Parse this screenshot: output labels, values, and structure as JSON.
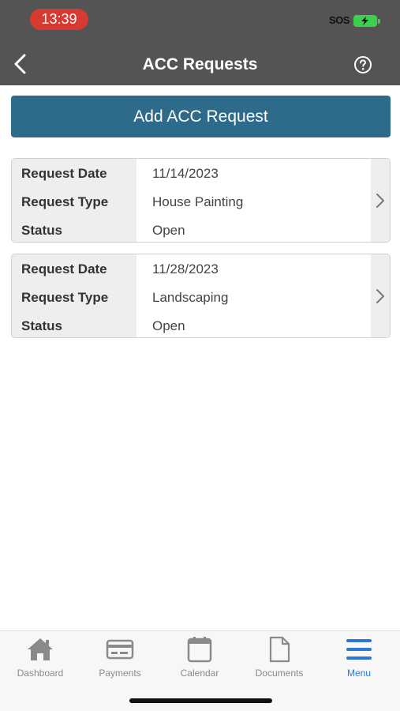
{
  "status_bar": {
    "time": "13:39",
    "network": "SOS"
  },
  "header": {
    "title": "ACC Requests"
  },
  "add_button": {
    "label": "Add ACC Request"
  },
  "requests": [
    {
      "rows": [
        {
          "label": "Request Date",
          "value": "11/14/2023"
        },
        {
          "label": "Request Type",
          "value": "House Painting"
        },
        {
          "label": "Status",
          "value": "Open"
        }
      ]
    },
    {
      "rows": [
        {
          "label": "Request Date",
          "value": "11/28/2023"
        },
        {
          "label": "Request Type",
          "value": "Landscaping"
        },
        {
          "label": "Status",
          "value": "Open"
        }
      ]
    }
  ],
  "tab_bar": {
    "active": "Menu",
    "tabs": [
      {
        "label": "Dashboard",
        "icon": "home-icon"
      },
      {
        "label": "Payments",
        "icon": "credit-card-icon"
      },
      {
        "label": "Calendar",
        "icon": "calendar-icon"
      },
      {
        "label": "Documents",
        "icon": "document-icon"
      },
      {
        "label": "Menu",
        "icon": "hamburger-menu-icon"
      }
    ]
  },
  "colors": {
    "header_bg": "#545454",
    "primary_button": "#2e6a89",
    "active_tab": "#2b78d6",
    "time_pill": "#d63a33",
    "battery": "#3bd14d"
  }
}
